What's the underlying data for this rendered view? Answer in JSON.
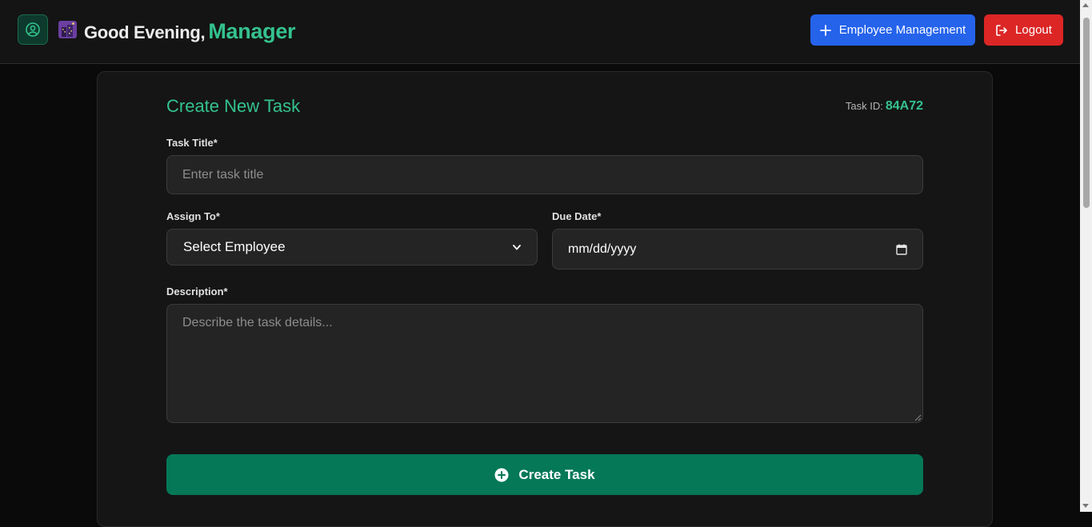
{
  "header": {
    "greeting": "Good Evening,",
    "role": "Manager",
    "employee_management_label": "Employee Management",
    "logout_label": "Logout"
  },
  "form": {
    "title": "Create New Task",
    "task_id_label": "Task ID:",
    "task_id_value": "84A72",
    "task_title_label": "Task Title*",
    "task_title_placeholder": "Enter task title",
    "assign_to_label": "Assign To*",
    "assign_to_selected": "Select Employee",
    "due_date_label": "Due Date*",
    "due_date_placeholder": "mm/dd/yyyy",
    "description_label": "Description*",
    "description_placeholder": "Describe the task details...",
    "submit_label": "Create Task"
  },
  "colors": {
    "accent": "#34c28f",
    "primary_button": "#2563eb",
    "danger_button": "#dc2626",
    "submit_button": "#047857"
  },
  "icons": {
    "profile": "user-circle-icon",
    "greeting": "night-city-icon",
    "employee_management": "plus-icon",
    "logout": "logout-icon",
    "due_date": "calendar-icon",
    "submit": "plus-circle-icon"
  }
}
